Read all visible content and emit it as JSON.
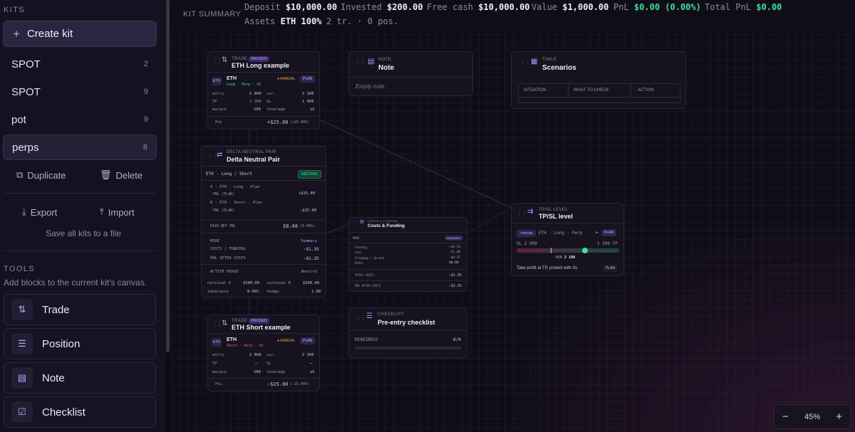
{
  "sidebar": {
    "kits_heading": "KITS",
    "create_kit_label": "Create kit",
    "kits": [
      {
        "name": "SPOT",
        "count": "2"
      },
      {
        "name": "SPOT",
        "count": "9"
      },
      {
        "name": "pot",
        "count": "9"
      },
      {
        "name": "perps",
        "count": "8"
      }
    ],
    "duplicate_label": "Duplicate",
    "delete_label": "Delete",
    "export_label": "Export",
    "import_label": "Import",
    "save_all_label": "Save all kits to a file",
    "tools_heading": "TOOLS",
    "tools_subtitle": "Add blocks to the current kit's canvas.",
    "tools": [
      {
        "label": "Trade",
        "icon": "trade-icon"
      },
      {
        "label": "Position",
        "icon": "database-icon"
      },
      {
        "label": "Note",
        "icon": "note-icon"
      },
      {
        "label": "Checklist",
        "icon": "checklist-icon"
      }
    ]
  },
  "summary": {
    "label": "KIT SUMMARY",
    "deposit_label": "Deposit",
    "deposit_value": "$10,000.00",
    "invested_label": "Invested",
    "invested_value": "$200.00",
    "free_cash_label": "Free cash",
    "free_cash_value": "$10,000.00",
    "value_label": "Value",
    "value_value": "$1,000.00",
    "pnl_label": "PnL",
    "pnl_value": "$0.00 (0.00%)",
    "total_pnl_label": "Total PnL",
    "total_pnl_value": "$0.00",
    "assets_label": "Assets",
    "assets_value": "ETH 100%",
    "counts": "2 tr. · 0 pos."
  },
  "cards": {
    "trade_long": {
      "type": "TRADE",
      "badge": "PAUSED",
      "title": "ETH Long example",
      "asset": "ETH",
      "asset_tag": "ETH",
      "sub": "Long · Perp · x5",
      "manual": "MANUAL",
      "plan": "PLAN",
      "entry_label": "entry",
      "entry": "2 000",
      "cur_label": "cur.",
      "cur": "2 100",
      "tp_label": "TP",
      "tp": "2 200",
      "sl_label": "SL",
      "sl": "1 900",
      "margin_label": "margin",
      "margin": "100",
      "leverage_label": "leverage",
      "leverage": "x5",
      "pnl_label": "PnL",
      "pnl": "+$25.00",
      "pnl_pct": "(+25.00%)"
    },
    "note": {
      "type": "NOTE",
      "title": "Note",
      "body": "Empty note."
    },
    "table": {
      "type": "TABLE",
      "title": "Scenarios",
      "cols": [
        "SITUATION",
        "WHAT TO CHECK",
        "ACTION"
      ]
    },
    "delta": {
      "type": "DELTA NEUTRAL PAIR",
      "title": "Delta Neutral Pair",
      "pair": "ETH · Long / Short",
      "neutral": "NEUTRAL",
      "a_label": "A · ETH · Long · Plan",
      "a_pnl_label": "PNL (PLAN)",
      "a_pnl": "+$25.00",
      "b_label": "B · ETH · Short · Plan",
      "b_pnl_label": "PNL (PLAN)",
      "b_pnl": "-$25.00",
      "net_label": "PAIR NET PNL",
      "net": "$0.00",
      "net_pct": "(0.00%)",
      "mode_label": "MODE",
      "mode": "Summary",
      "costs_label": "COSTS / FUNDING",
      "costs": "-$1.35",
      "after_label": "PNL AFTER COSTS",
      "after": "-$1.35",
      "hedge_label": "ACTIVE HEDGE",
      "hedge": "Neutral",
      "notional_a_label": "notional A",
      "notional_a": "$500.00",
      "notional_b_label": "notional B",
      "notional_b": "$500.00",
      "imbalance_label": "imbalance",
      "imbalance": "0.00%",
      "hedge_ratio_label": "hedge",
      "hedge_ratio": "1.00"
    },
    "costs": {
      "type": "COSTS & FUNDING",
      "title": "Costs & Funding",
      "mode_label": "MODE",
      "mode": "SUMMARY",
      "rows": [
        {
          "label": "Funding",
          "value": "+$0.50"
        },
        {
          "label": "Fees",
          "value": "-$1.60"
        },
        {
          "label": "Slippage / Spread",
          "value": "-$0.25"
        },
        {
          "label": "Other",
          "value": "$0.00"
        }
      ],
      "total_label": "TOTAL COSTS",
      "total": "-$1.35",
      "after_label": "PNL AFTER COSTS",
      "after": "-$1.35"
    },
    "tpsl": {
      "type": "TP/SL LEVEL",
      "title": "TP/SL level",
      "link": "↗TRADE",
      "sub": "ETH · Long · Perp",
      "plan": "PLAN",
      "sl": "SL 1 900",
      "tp": "2 200 TP",
      "now_label": "NOW",
      "now": "2 100",
      "progress": 0.67,
      "note": "Take profit at TP, protect with SL",
      "plan2": "PLAN"
    },
    "trade_short": {
      "type": "TRADE",
      "badge": "PAUSED",
      "title": "ETH Short example",
      "asset": "ETH",
      "asset_tag": "ETH",
      "sub": "Short · Perp · x5",
      "manual": "MANUAL",
      "plan": "PLAN",
      "entry_label": "entry",
      "entry": "2 000",
      "cur_label": "cur.",
      "cur": "2 100",
      "tp_label": "TP",
      "tp": "—",
      "sl_label": "SL",
      "sl": "—",
      "margin_label": "margin",
      "margin": "100",
      "leverage_label": "leverage",
      "leverage": "x5",
      "pnl_label": "PnL",
      "pnl": "-$25.00",
      "pnl_pct": "(-25.00%)"
    },
    "checklist": {
      "type": "CHECKLIST",
      "title": "Pre-entry checklist",
      "readiness_label": "READINESS",
      "readiness": "0/0"
    }
  },
  "zoom": {
    "minus": "−",
    "level": "45%",
    "plus": "+"
  }
}
